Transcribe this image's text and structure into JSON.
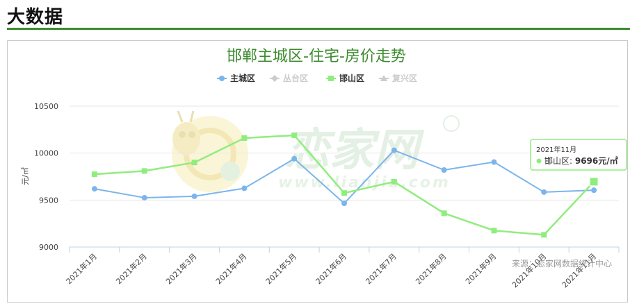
{
  "page": {
    "title": "大数据"
  },
  "watermark": {
    "brand": "恋家网",
    "domain": "www.lianjia.com"
  },
  "chart_data": {
    "type": "line",
    "title": "邯郸主城区-住宅-房价走势",
    "ylabel": "元/㎡",
    "xlabel": "",
    "ylim": [
      9000,
      10500
    ],
    "yticks": [
      9000,
      9500,
      10000,
      10500
    ],
    "grid": true,
    "legend_position": "top-center",
    "categories": [
      "2021年1月",
      "2021年2月",
      "2021年3月",
      "2021年4月",
      "2021年5月",
      "2021年6月",
      "2021年7月",
      "2021年8月",
      "2021年9月",
      "2021年10月",
      "2021年11月"
    ],
    "series": [
      {
        "name": "主城区",
        "color": "#7cb5ec",
        "marker": "circle",
        "visible": true,
        "values": [
          9620,
          9525,
          9540,
          9625,
          9940,
          9465,
          10030,
          9820,
          9905,
          9585,
          9605
        ]
      },
      {
        "name": "丛台区",
        "color": "#cccccc",
        "marker": "diamond",
        "visible": false,
        "values": []
      },
      {
        "name": "邯山区",
        "color": "#90ed7d",
        "marker": "square",
        "visible": true,
        "values": [
          9775,
          9810,
          9900,
          10160,
          10190,
          9575,
          9695,
          9360,
          9175,
          9130,
          9696
        ]
      },
      {
        "name": "复兴区",
        "color": "#cccccc",
        "marker": "triangle",
        "visible": false,
        "values": []
      }
    ],
    "tooltip": {
      "category": "2021年11月",
      "series": "邯山区",
      "text": "邯山区: ",
      "value": "9696元/㎡"
    },
    "source": "来源：恋家网数据统计中心"
  }
}
